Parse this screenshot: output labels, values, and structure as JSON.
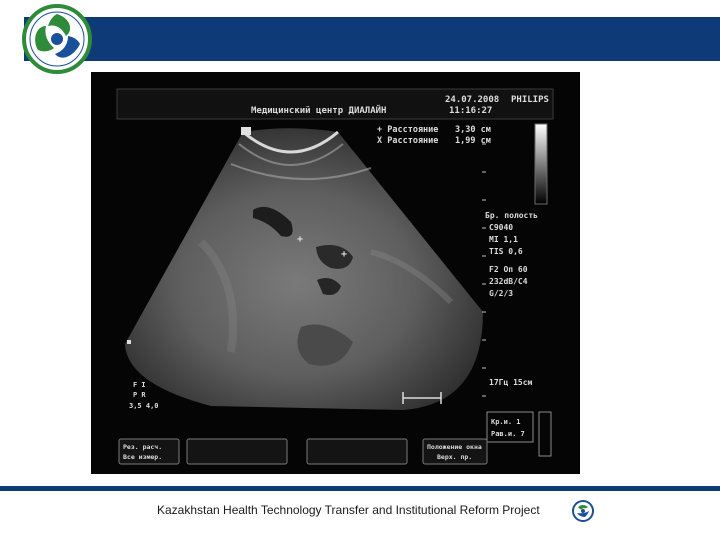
{
  "slide": {
    "footer_text": "Kazakhstan Health Technology Transfer and Institutional Reform Project",
    "colors": {
      "brand_blue": "#0e3a78",
      "logo_green": "#2e8b3a",
      "logo_blue": "#1a4f9c"
    }
  },
  "ultrasound": {
    "header_title": "Медицинский центр ДИАЛАЙН",
    "date": "24.07.2008",
    "time": "11:16:27",
    "brand": "PHILIPS",
    "measurements": [
      {
        "label": "+ Расстояние",
        "value": "3,30 см"
      },
      {
        "label": "X Расстояние",
        "value": "1,99 см"
      }
    ],
    "settings": [
      "Бр. полость",
      "C9040",
      "MI 1,1",
      "TIS 0,6",
      "F2   Оп 60",
      "232dB/C4",
      "G/2/3"
    ],
    "freq_depth": "17Гц   15см",
    "left_scale": [
      "F  I",
      "P  R",
      "3,5 4,0"
    ],
    "bottom_buttons": [
      {
        "line1": "Рез. расч.",
        "line2": "Все измер."
      },
      {
        "line1": "",
        "line2": ""
      },
      {
        "line1": "",
        "line2": ""
      },
      {
        "line1": "Положение окна",
        "line2": "Верх. пр."
      }
    ],
    "right_box": [
      "Кр.и. 1",
      "Рав.и. 7"
    ]
  }
}
